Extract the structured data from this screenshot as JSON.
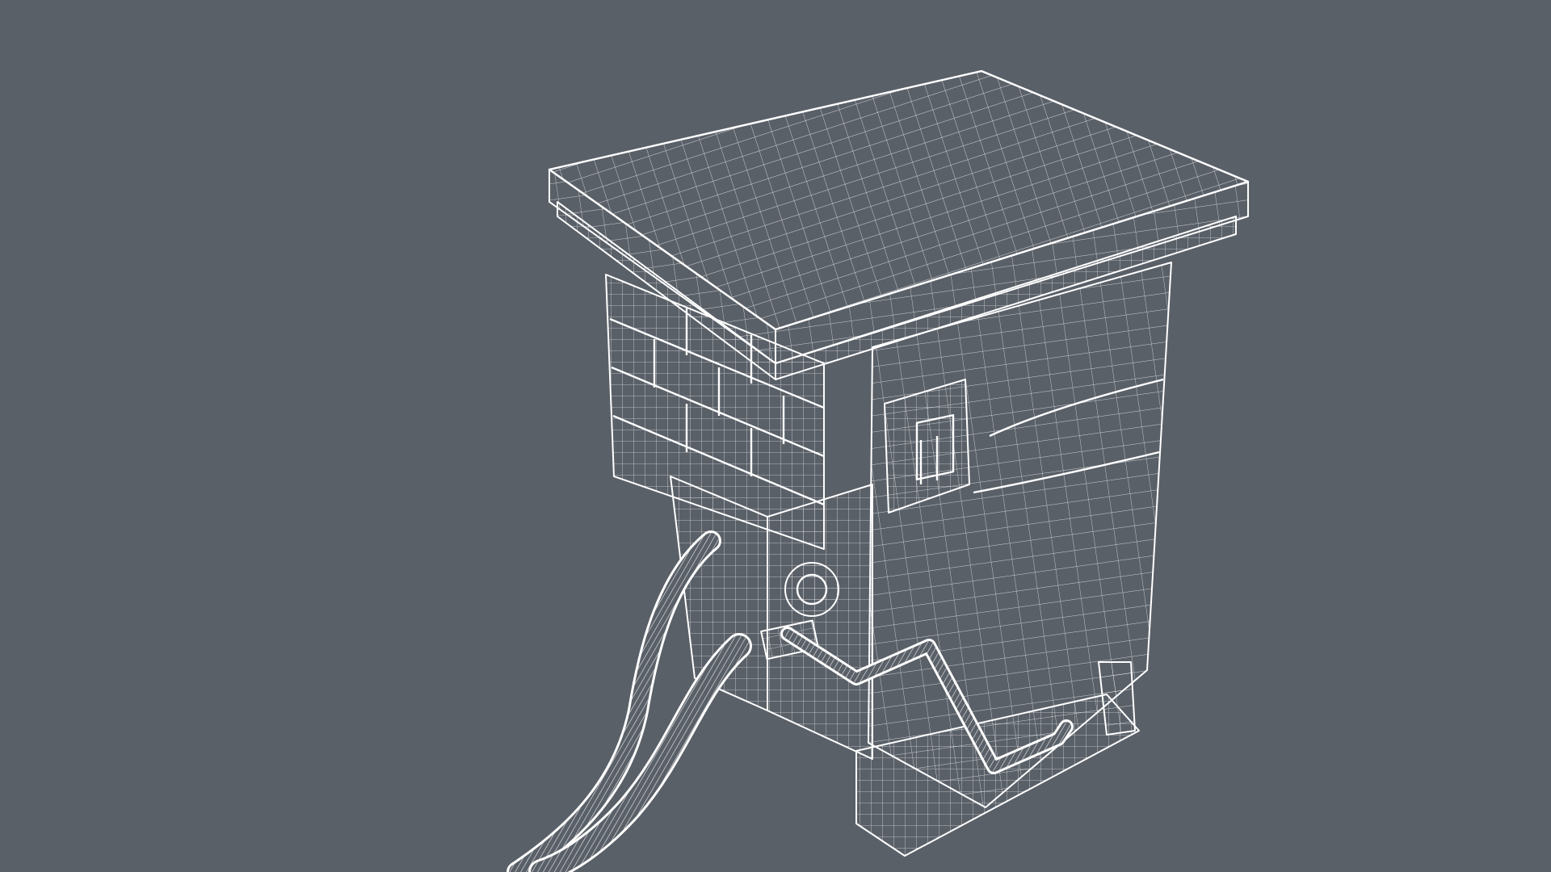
{
  "viewport": {
    "background_color": "#5a6068",
    "wire_color": "#ffffff",
    "render_mode": "wireframe"
  },
  "model": {
    "subject": "fuel-pump-kiosk",
    "parts": [
      "roof-slab",
      "front-brick-wall",
      "side-panel",
      "window",
      "hose-left",
      "hose-right",
      "handle-rail",
      "nozzle-reel",
      "base-plinth"
    ]
  }
}
